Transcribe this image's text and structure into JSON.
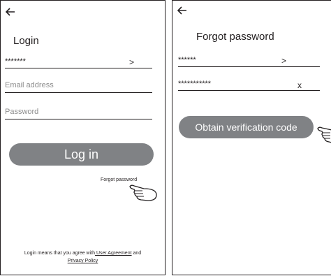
{
  "login_screen": {
    "title": "Login",
    "account_masked": "*******",
    "account_arrow": ">",
    "email_placeholder": "Email address",
    "password_placeholder": "Password",
    "login_button": "Log in",
    "forgot_link": "Forgot password",
    "footer_prefix": "Login means that you agree with",
    "user_agreement": " User Agreement",
    "footer_and": " and",
    "privacy_policy": "Privacy Policy "
  },
  "forgot_screen": {
    "title": "Forgot password",
    "account_masked": "******",
    "account_arrow": ">",
    "phone_masked": "***********",
    "clear_button": "x",
    "verify_button": "Obtain verification code"
  },
  "colors": {
    "button": "#808285",
    "line": "#231f20"
  }
}
